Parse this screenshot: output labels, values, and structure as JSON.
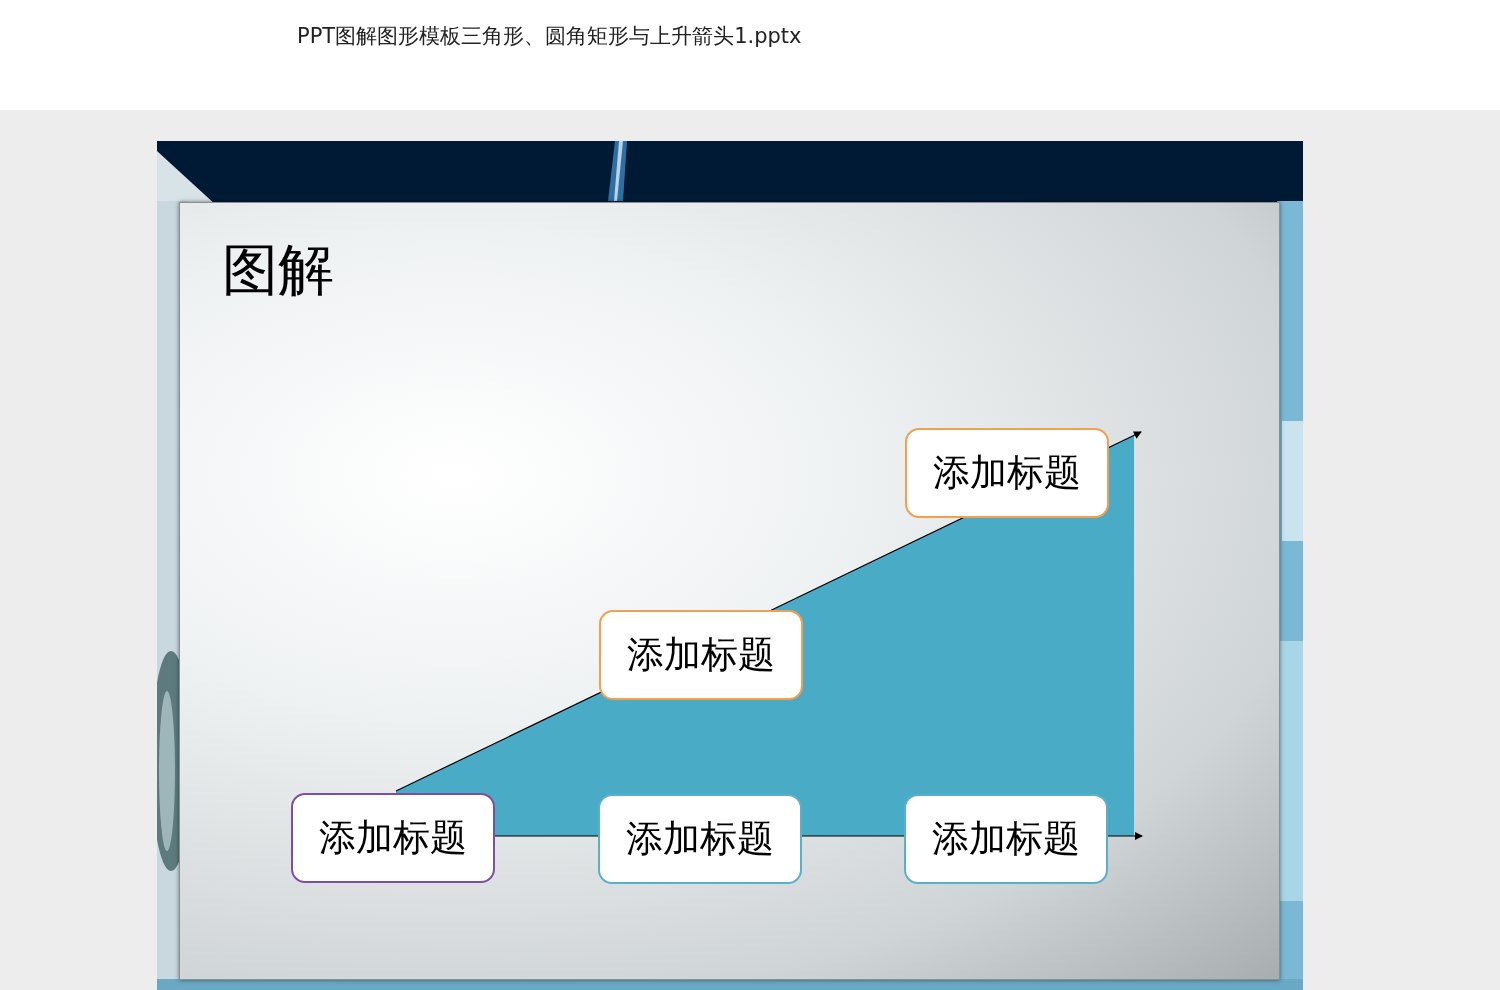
{
  "document": {
    "filename": "PPT图解图形模板三角形、圆角矩形与上升箭头1.pptx"
  },
  "slide": {
    "title": "图解",
    "nodes": [
      {
        "label": "添加标题",
        "color": "#7e4ea6"
      },
      {
        "label": "添加标题",
        "color": "#5ab0c8"
      },
      {
        "label": "添加标题",
        "color": "#5ab0c8"
      },
      {
        "label": "添加标题",
        "color": "#f0a050"
      },
      {
        "label": "添加标题",
        "color": "#f0a050"
      }
    ]
  }
}
